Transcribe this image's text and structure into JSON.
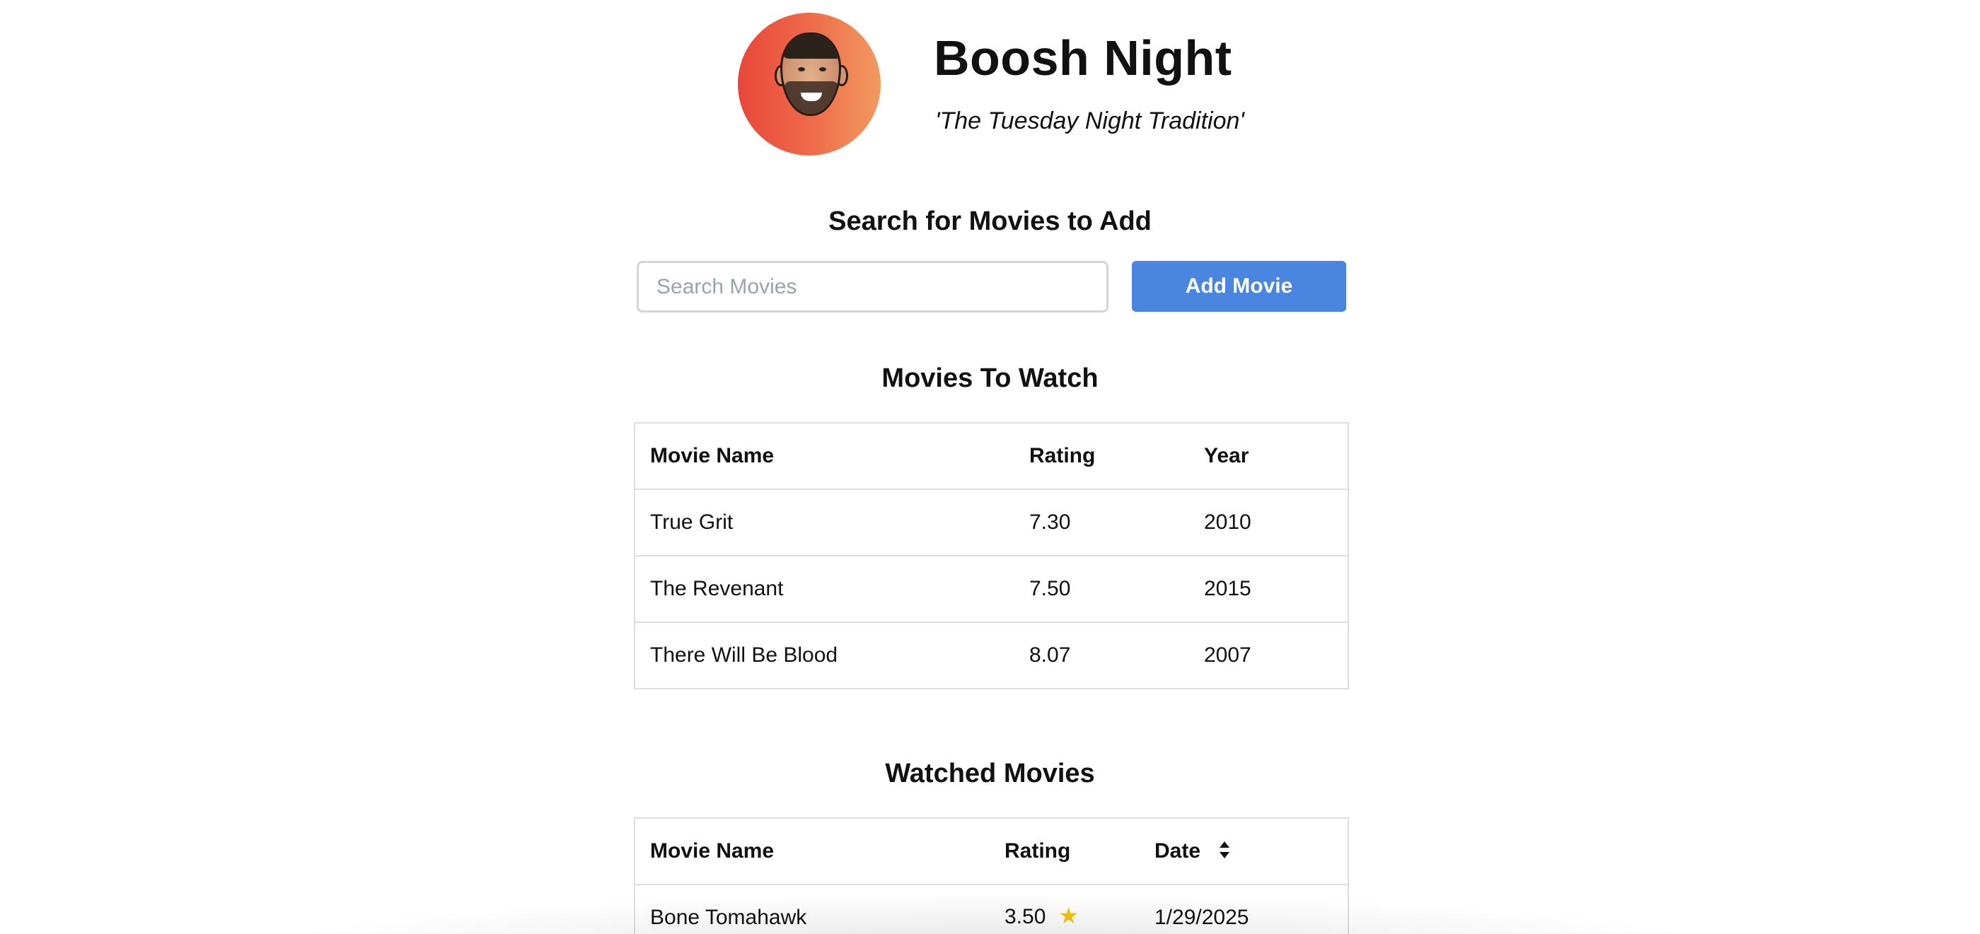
{
  "header": {
    "title": "Boosh Night",
    "subtitle": "'The Tuesday Night Tradition'",
    "avatar_icon": "face-avatar"
  },
  "search": {
    "heading": "Search for Movies to Add",
    "placeholder": "Search Movies",
    "value": "",
    "button_label": "Add Movie"
  },
  "to_watch": {
    "heading": "Movies To Watch",
    "columns": [
      "Movie Name",
      "Rating",
      "Year"
    ],
    "rows": [
      {
        "name": "True Grit",
        "rating": "7.30",
        "year": "2010"
      },
      {
        "name": "The Revenant",
        "rating": "7.50",
        "year": "2015"
      },
      {
        "name": "There Will Be Blood",
        "rating": "8.07",
        "year": "2007"
      }
    ]
  },
  "watched": {
    "heading": "Watched Movies",
    "columns": [
      "Movie Name",
      "Rating",
      "Date"
    ],
    "sort_icon": "sort-icon",
    "rows": [
      {
        "name": "Bone Tomahawk",
        "rating": "3.50",
        "date": "1/29/2025",
        "rating_icon": "star-icon"
      }
    ]
  },
  "colors": {
    "accent_button": "#4a86e0",
    "avatar_gradient_start": "#e8473b",
    "avatar_gradient_end": "#f29a61",
    "star": "#f5c518"
  }
}
